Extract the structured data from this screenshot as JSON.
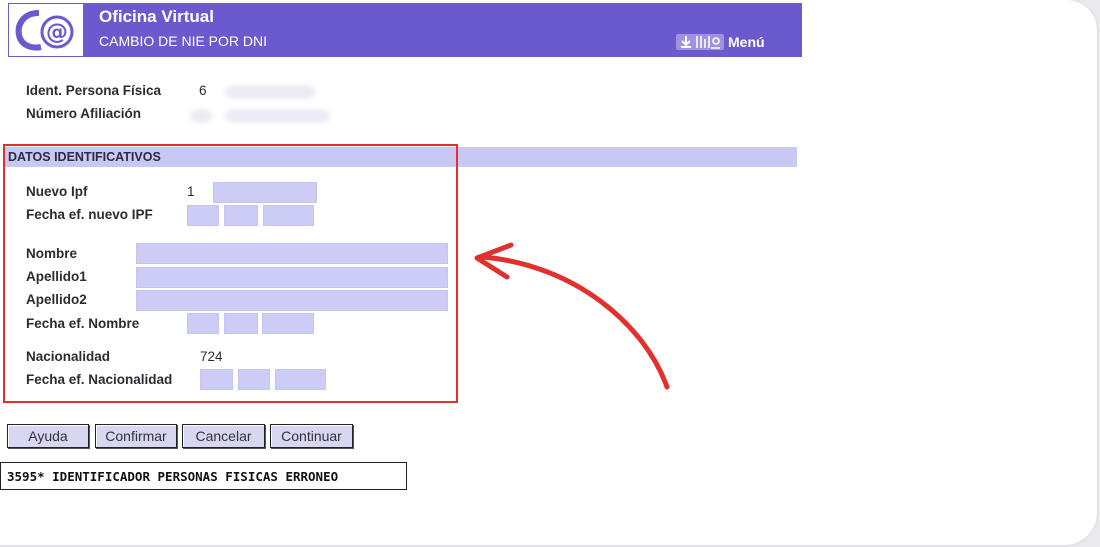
{
  "header": {
    "title": "Oficina Virtual",
    "subtitle": "CAMBIO DE NIE POR DNI",
    "menu_label": "Menú"
  },
  "identity": {
    "ipf_label": "Ident. Persona Física",
    "ipf_value": "6",
    "afiliacion_label": "Número Afiliación"
  },
  "section": {
    "title": "DATOS IDENTIFICATIVOS",
    "nuevo_ipf_label": "Nuevo Ipf",
    "nuevo_ipf_value": "1",
    "fecha_nuevo_ipf_label": "Fecha ef. nuevo IPF",
    "nombre_label": "Nombre",
    "apellido1_label": "Apellido1",
    "apellido2_label": "Apellido2",
    "fecha_nombre_label": "Fecha ef. Nombre",
    "nacionalidad_label": "Nacionalidad",
    "nacionalidad_value": "724",
    "fecha_nacionalidad_label": "Fecha ef. Nacionalidad"
  },
  "buttons": {
    "ayuda": "Ayuda",
    "confirmar": "Confirmar",
    "cancelar": "Cancelar",
    "continuar": "Continuar"
  },
  "error_message": "3595* IDENTIFICADOR PERSONAS FISICAS ERRONEO",
  "colors": {
    "header_bg": "#6a5acd",
    "field_bg": "#ccccf7",
    "highlight_red": "#e0312e"
  }
}
